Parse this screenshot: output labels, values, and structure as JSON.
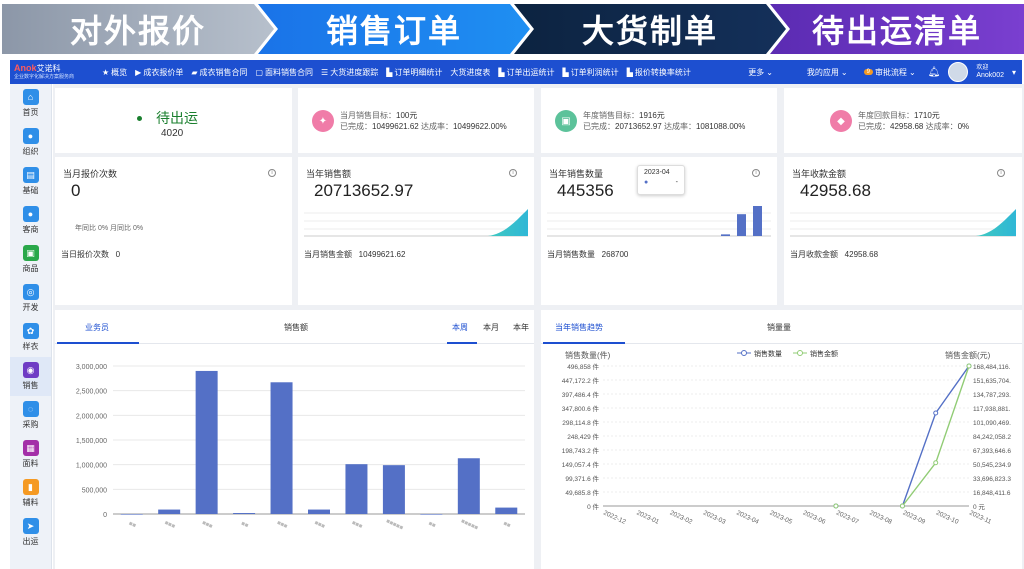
{
  "banner": {
    "steps": [
      "对外报价",
      "销售订单",
      "大货制单",
      "待出运清单"
    ]
  },
  "topnav": {
    "logo_name": "艾诺科",
    "logo_sub": "企业数字化解决方案服务商",
    "items": [
      "概览",
      "成衣报价单",
      "成衣销售合同",
      "面料销售合同",
      "大货进度跟踪",
      "订单明细统计",
      "大货进度表",
      "订单出运统计",
      "订单利润统计",
      "报价转换率统计"
    ],
    "more": "更多",
    "my_apps": "我的应用",
    "approval": "审批流程",
    "badge": "9",
    "welcome": "欢迎",
    "username": "Anok002"
  },
  "sidebar": {
    "items": [
      {
        "label": "首页",
        "icon": "home-icon",
        "color": "#2f8fe8"
      },
      {
        "label": "组织",
        "icon": "org-icon",
        "color": "#2f8fe8"
      },
      {
        "label": "基础",
        "icon": "doc-icon",
        "color": "#2f8fe8"
      },
      {
        "label": "客商",
        "icon": "people-icon",
        "color": "#2f8fe8"
      },
      {
        "label": "商品",
        "icon": "goods-icon",
        "color": "#2aa84a"
      },
      {
        "label": "开发",
        "icon": "dev-icon",
        "color": "#2f8fe8"
      },
      {
        "label": "样衣",
        "icon": "sample-icon",
        "color": "#2f8fe8"
      },
      {
        "label": "销售",
        "icon": "sales-icon",
        "color": "#6f3cc4"
      },
      {
        "label": "采购",
        "icon": "purchase-icon",
        "color": "#2f8fe8"
      },
      {
        "label": "面料",
        "icon": "fabric-icon",
        "color": "#a32fa8"
      },
      {
        "label": "辅料",
        "icon": "accessory-icon",
        "color": "#f59a23"
      },
      {
        "label": "出运",
        "icon": "ship-icon",
        "color": "#2f8fe8"
      }
    ]
  },
  "row1": {
    "pending": {
      "label": "待出运",
      "value": "4020"
    },
    "month": {
      "target_label": "当月销售目标：",
      "target": "100元",
      "done_label": "已完成：",
      "done": "10499621.62",
      "rate_label": "达成率：",
      "rate": "10499622.00%"
    },
    "year_sales": {
      "target_label": "年度销售目标：",
      "target": "1916元",
      "done_label": "已完成：",
      "done": "20713652.97",
      "rate_label": "达成率：",
      "rate": "1081088.00%"
    },
    "year_collect": {
      "target_label": "年度回款目标：",
      "target": "1710元",
      "done_label": "已完成：",
      "done": "42958.68",
      "rate_label": "达成率：",
      "rate": "0%"
    }
  },
  "row2": {
    "quotes": {
      "title": "当月报价次数",
      "value": "0",
      "compare": "年同比 0% 月同比 0%",
      "foot_label": "当日报价次数",
      "foot_value": "0"
    },
    "sales_amount": {
      "title": "当年销售额",
      "value": "20713652.97",
      "foot_label": "当月销售金额",
      "foot_value": "10499621.62"
    },
    "sales_qty": {
      "title": "当年销售数量",
      "value": "445356",
      "tooltip_month": "2023-04",
      "tooltip_value": "-",
      "foot_label": "当月销售数量",
      "foot_value": "268700",
      "mini_bars": [
        3,
        40,
        55
      ]
    },
    "collect": {
      "title": "当年收款金额",
      "value": "42958.68",
      "foot_label": "当月收款金额",
      "foot_value": "42958.68"
    }
  },
  "left_panel": {
    "tabs": [
      "业务员",
      "销售额"
    ],
    "periods": [
      "本周",
      "本月",
      "本年"
    ]
  },
  "right_panel": {
    "tabs": [
      "当年销售趋势",
      "销量量"
    ],
    "legend": [
      "销售数量",
      "销售金额"
    ],
    "left_axis_title": "销售数量(件)",
    "right_axis_title": "销售金额(元)"
  },
  "colors": {
    "accent": "#1d4fd0",
    "bar": "#5470c6",
    "line2": "#91cc75"
  },
  "chart_data": [
    {
      "type": "bar",
      "title": "",
      "categories": [
        "■■",
        "■■■",
        "■■■",
        "■■",
        "■■■",
        "■■■",
        "■■■",
        "■■■■■",
        "■■",
        "■■■■■",
        "■■"
      ],
      "values": [
        0,
        90000,
        2900000,
        20000,
        2670000,
        90000,
        1010000,
        990000,
        0,
        1130000,
        130000
      ],
      "ylim": [
        0,
        3000000
      ],
      "yticks": [
        "0",
        "500,000",
        "1,000,000",
        "1,500,000",
        "2,000,000",
        "2,500,000",
        "3,000,000"
      ],
      "grid": true
    },
    {
      "type": "line",
      "title": "",
      "categories": [
        "2022-12",
        "2023-01",
        "2023-02",
        "2023-03",
        "2023-04",
        "2023-05",
        "2023-06",
        "2023-07",
        "2023-08",
        "2023-09",
        "2023-10",
        "2023-11"
      ],
      "series": [
        {
          "name": "销售数量",
          "axis": "left",
          "values": [
            null,
            null,
            null,
            null,
            null,
            null,
            null,
            0,
            null,
            0,
            330000,
            496858
          ]
        },
        {
          "name": "销售金额",
          "axis": "right",
          "values": [
            null,
            null,
            null,
            null,
            null,
            null,
            null,
            0,
            null,
            0,
            52000000,
            168484116
          ]
        }
      ],
      "left_ticks": [
        "0 件",
        "49,685.8 件",
        "99,371.6 件",
        "149,057.4 件",
        "198,743.2 件",
        "248,429 件",
        "298,114.8 件",
        "347,800.6 件",
        "397,486.4 件",
        "447,172.2 件",
        "496,858 件"
      ],
      "right_ticks": [
        "0 元",
        "16,848,411.6",
        "33,696,823.3",
        "50,545,234.9",
        "67,393,646.6",
        "84,242,058.2",
        "101,090,469.",
        "117,938,881.",
        "134,787,293.",
        "151,635,704.",
        "168,484,116."
      ],
      "left_max": 496858,
      "right_max": 168484116,
      "legend": "top-center",
      "grid": true
    }
  ]
}
